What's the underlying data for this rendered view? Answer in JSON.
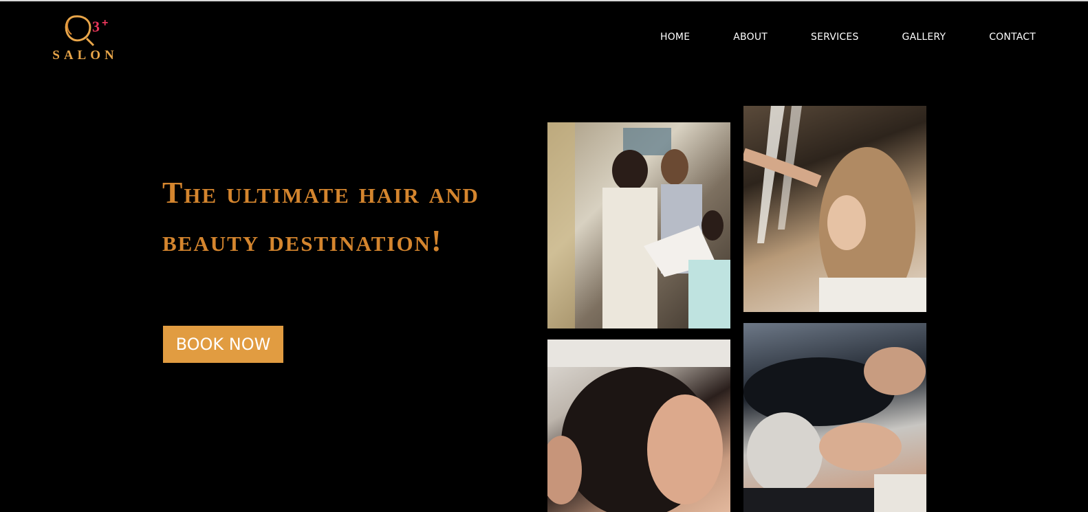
{
  "brand": {
    "logo_mark": "Q3+",
    "logo_text": "SALON",
    "accent": "#d4852e",
    "button_color": "#e19c41"
  },
  "nav": {
    "items": [
      "HOME",
      "ABOUT",
      "SERVICES",
      "GALLERY",
      "CONTACT"
    ]
  },
  "hero": {
    "title": "The ultimate hair and beauty destination!",
    "cta_label": "BOOK NOW"
  },
  "gallery": {
    "photos": [
      {
        "alt": "stylists-with-colour-chart"
      },
      {
        "alt": "hair-styling-with-mist"
      },
      {
        "alt": "woman-hair-wash"
      },
      {
        "alt": "clients-at-wash-basins"
      }
    ]
  }
}
